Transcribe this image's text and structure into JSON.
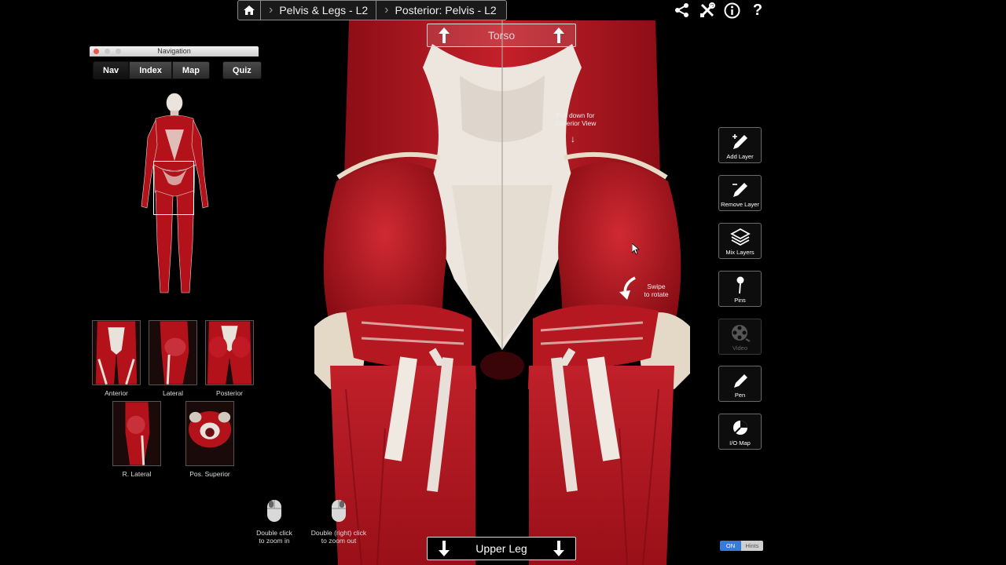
{
  "breadcrumb": {
    "level1": "Pelvis & Legs - L2",
    "level2": "Posterior: Pelvis - L2"
  },
  "panel": {
    "title": "Navigation",
    "tabs": [
      {
        "label": "Nav",
        "active": true
      },
      {
        "label": "Index",
        "active": false
      },
      {
        "label": "Map",
        "active": false
      },
      {
        "label": "Quiz",
        "active": false
      }
    ]
  },
  "views": [
    {
      "label": "Anterior"
    },
    {
      "label": "Lateral"
    },
    {
      "label": "Posterior"
    },
    {
      "label": "R. Lateral"
    },
    {
      "label": "Pos. Superior"
    }
  ],
  "main": {
    "top_nav": "Torso",
    "bottom_nav": "Upper Leg",
    "hint_superior": "Pull down for\nSuperior View",
    "hint_rotate": "Swipe\nto rotate",
    "zoom_in_hint": "Double click\nto zoom in",
    "zoom_out_hint": "Double (right) click\nto zoom out"
  },
  "tools": [
    {
      "label": "Add Layer",
      "icon": "add-layer-icon",
      "enabled": true
    },
    {
      "label": "Remove Layer",
      "icon": "remove-layer-icon",
      "enabled": true
    },
    {
      "label": "Mix Layers",
      "icon": "layers-icon",
      "enabled": true
    },
    {
      "label": "Pins",
      "icon": "pin-icon",
      "enabled": true
    },
    {
      "label": "Video",
      "icon": "film-reel-icon",
      "enabled": false
    },
    {
      "label": "Pen",
      "icon": "pen-icon",
      "enabled": true
    },
    {
      "label": "I/O Map",
      "icon": "io-map-icon",
      "enabled": true
    }
  ],
  "hints_toggle": {
    "on_label": "ON",
    "off_label": "Hints"
  },
  "colors": {
    "muscle": "#b3121b",
    "tendon": "#e8e2da",
    "accent": "#3b7ad8"
  }
}
